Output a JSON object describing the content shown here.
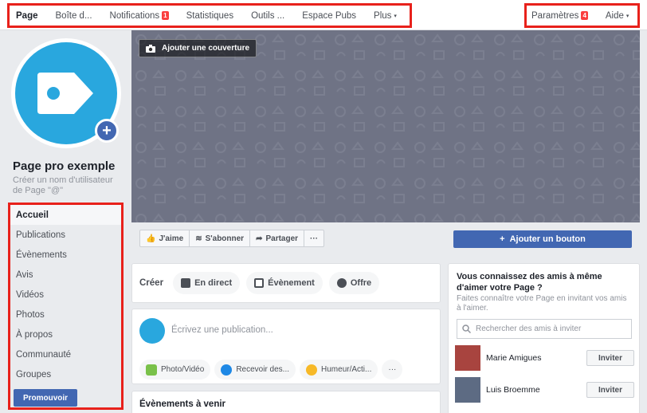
{
  "topnav": {
    "left_items": [
      {
        "label": "Page",
        "active": true
      },
      {
        "label": "Boîte d..."
      },
      {
        "label": "Notifications",
        "badge": "1"
      },
      {
        "label": "Statistiques"
      },
      {
        "label": "Outils ..."
      },
      {
        "label": "Espace Pubs"
      },
      {
        "label": "Plus",
        "caret": "▾"
      }
    ],
    "settings_label": "Paramètres",
    "settings_badge": "4",
    "help_label": "Aide",
    "help_caret": "▾"
  },
  "profile": {
    "page_name": "Page pro exemple",
    "username_hint": "Créer un nom d'utilisateur de Page \"@\"",
    "avatar_icon": "tag-icon",
    "add_photo_symbol": "+"
  },
  "sidebar": {
    "items": [
      {
        "label": "Accueil",
        "active": true
      },
      {
        "label": "Publications"
      },
      {
        "label": "Évènements"
      },
      {
        "label": "Avis"
      },
      {
        "label": "Vidéos"
      },
      {
        "label": "Photos"
      },
      {
        "label": "À propos"
      },
      {
        "label": "Communauté"
      },
      {
        "label": "Groupes"
      }
    ],
    "promote_label": "Promouvoir"
  },
  "cover": {
    "add_cover_label": "Ajouter une couverture"
  },
  "actions": {
    "like_label": "J'aime",
    "follow_label": "S'abonner",
    "share_label": "Partager",
    "more_label": "···",
    "add_button_label": "Ajouter un bouton",
    "add_button_symbol": "+"
  },
  "create": {
    "label": "Créer",
    "live_label": "En direct",
    "event_label": "Évènement",
    "offer_label": "Offre"
  },
  "composer": {
    "placeholder": "Écrivez une publication...",
    "options": [
      {
        "label": "Photo/Vidéo",
        "color": "#7ac14a"
      },
      {
        "label": "Recevoir des...",
        "color": "#1e88e5"
      },
      {
        "label": "Humeur/Acti...",
        "color": "#f7b928"
      }
    ],
    "more_label": "···"
  },
  "events": {
    "title": "Évènements à venir"
  },
  "invite": {
    "title": "Vous connaissez des amis à même d'aimer votre Page ?",
    "description": "Faites connaître votre Page en invitant vos amis à l'aimer.",
    "search_placeholder": "Rechercher des amis à inviter",
    "friends": [
      {
        "name": "Marie Amigues",
        "button": "Inviter"
      },
      {
        "name": "Luis Broemme",
        "button": "Inviter"
      }
    ]
  },
  "colors": {
    "facebook_blue": "#4267b2",
    "avatar_blue": "#29a7de",
    "highlight_red": "#e8211b",
    "cover_gray": "#6f7385"
  }
}
